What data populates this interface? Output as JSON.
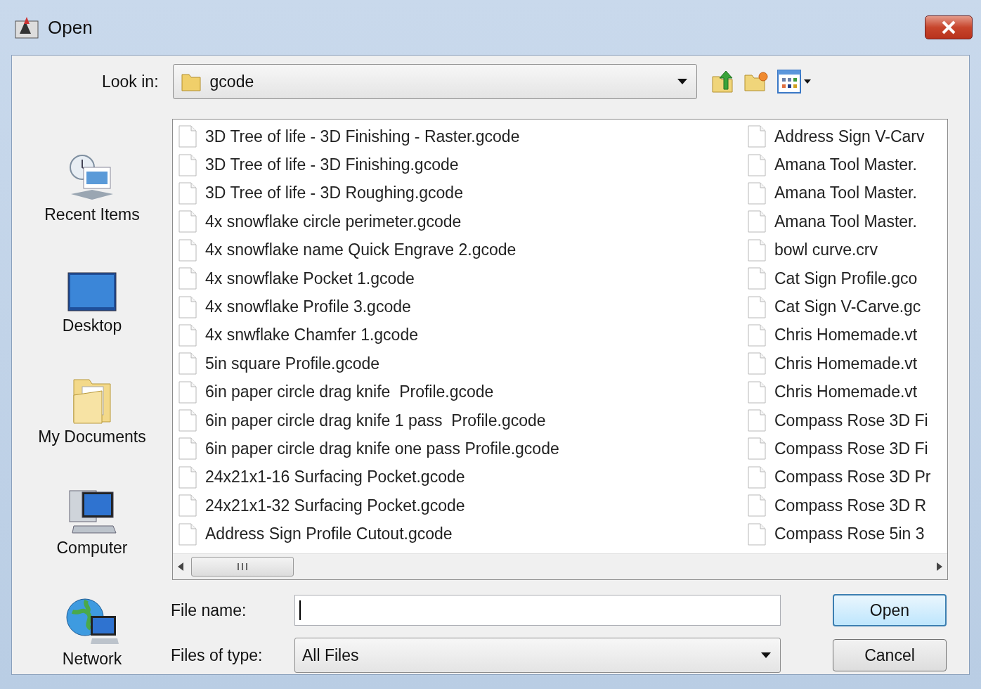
{
  "window": {
    "title": "Open"
  },
  "look_in": {
    "label": "Look in:",
    "value": "gcode"
  },
  "places": [
    {
      "label": "Recent Items",
      "kind": "recent"
    },
    {
      "label": "Desktop",
      "kind": "desktop"
    },
    {
      "label": "My Documents",
      "kind": "documents"
    },
    {
      "label": "Computer",
      "kind": "computer"
    },
    {
      "label": "Network",
      "kind": "network"
    }
  ],
  "file_columns": [
    [
      "3D Tree of life - 3D Finishing - Raster.gcode",
      "3D Tree of life - 3D Finishing.gcode",
      "3D Tree of life - 3D Roughing.gcode",
      "4x snowflake circle perimeter.gcode",
      "4x snowflake name Quick Engrave 2.gcode",
      "4x snowflake Pocket 1.gcode",
      "4x snowflake Profile 3.gcode",
      "4x snwflake Chamfer 1.gcode",
      "5in square Profile.gcode",
      "6in paper circle drag knife  Profile.gcode",
      "6in paper circle drag knife 1 pass  Profile.gcode",
      "6in paper circle drag knife one pass Profile.gcode",
      "24x21x1-16 Surfacing Pocket.gcode",
      "24x21x1-32 Surfacing Pocket.gcode",
      "Address Sign Profile Cutout.gcode"
    ],
    [
      "Address Sign V-Carv",
      "Amana Tool Master.",
      "Amana Tool Master.",
      "Amana Tool Master.",
      "bowl curve.crv",
      "Cat Sign Profile.gco",
      "Cat Sign V-Carve.gc",
      "Chris Homemade.vt",
      "Chris Homemade.vt",
      "Chris Homemade.vt",
      "Compass Rose 3D Fi",
      "Compass Rose 3D Fi",
      "Compass Rose 3D Pr",
      "Compass Rose 3D R",
      "Compass Rose 5in 3"
    ]
  ],
  "file_name": {
    "label": "File name:"
  },
  "file_type": {
    "label": "Files of type:",
    "value": "All Files"
  },
  "buttons": [
    {
      "label": "Open",
      "kind": "default"
    },
    {
      "label": "Cancel",
      "kind": "normal"
    }
  ]
}
